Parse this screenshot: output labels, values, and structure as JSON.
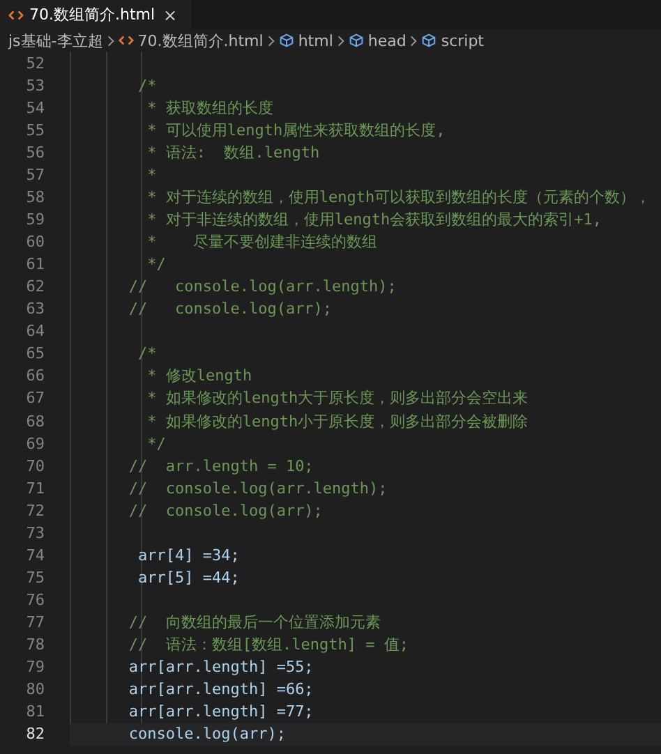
{
  "tabs": [
    {
      "label": "70.数组简介.html",
      "close": "×",
      "selected": true
    }
  ],
  "breadcrumb": [
    {
      "label": "js基础-李立超"
    },
    {
      "label": "70.数组简介.html",
      "kind": "file"
    },
    {
      "label": "html",
      "kind": "symbol"
    },
    {
      "label": "head",
      "kind": "symbol"
    },
    {
      "label": "script",
      "kind": "symbol"
    }
  ],
  "lines": [
    {
      "number": "52",
      "current": false
    },
    {
      "number": "53",
      "kind": "comment",
      "text": "        /*",
      "current": false
    },
    {
      "number": "54",
      "kind": "comment",
      "text": "         * 获取数组的长度",
      "current": false
    },
    {
      "number": "55",
      "kind": "comment",
      "text": "         * 可以使用length属性来获取数组的长度,",
      "current": false
    },
    {
      "number": "56",
      "kind": "comment",
      "text": "         * 语法:  数组.length",
      "current": false
    },
    {
      "number": "57",
      "kind": "comment",
      "text": "         *",
      "current": false
    },
    {
      "number": "58",
      "kind": "comment",
      "text": "         * 对于连续的数组，使用length可以获取到数组的长度（元素的个数），",
      "current": false
    },
    {
      "number": "59",
      "kind": "comment",
      "text": "         * 对于非连续的数组，使用length会获取到数组的最大的索引+1,",
      "current": false
    },
    {
      "number": "60",
      "kind": "comment",
      "text": "         *    尽量不要创建非连续的数组",
      "current": false
    },
    {
      "number": "61",
      "kind": "comment",
      "text": "         */",
      "current": false
    },
    {
      "number": "62",
      "kind": "comment",
      "text": "       //   console.log(arr.length);",
      "current": false
    },
    {
      "number": "63",
      "kind": "comment",
      "text": "       //   console.log(arr);",
      "current": false
    },
    {
      "number": "64",
      "current": false
    },
    {
      "number": "65",
      "kind": "comment",
      "text": "        /*",
      "current": false
    },
    {
      "number": "66",
      "kind": "comment",
      "text": "         * 修改length",
      "current": false
    },
    {
      "number": "67",
      "kind": "comment",
      "text": "         * 如果修改的length大于原长度，则多出部分会空出来",
      "current": false
    },
    {
      "number": "68",
      "kind": "comment",
      "text": "         * 如果修改的length小于原长度，则多出部分会被删除",
      "current": false
    },
    {
      "number": "69",
      "kind": "comment",
      "text": "         */",
      "current": false
    },
    {
      "number": "70",
      "kind": "comment",
      "text": "       //  arr.length = 10;",
      "current": false
    },
    {
      "number": "71",
      "kind": "comment",
      "text": "       //  console.log(arr.length);",
      "current": false
    },
    {
      "number": "72",
      "kind": "comment",
      "text": "       //  console.log(arr);",
      "current": false
    },
    {
      "number": "73",
      "current": false
    },
    {
      "number": "74",
      "kind": "code",
      "text": "        arr[4] =34;",
      "current": false
    },
    {
      "number": "75",
      "kind": "code",
      "text": "        arr[5] =44;",
      "current": false
    },
    {
      "number": "76",
      "current": false
    },
    {
      "number": "77",
      "kind": "comment",
      "text": "       //  向数组的最后一个位置添加元素",
      "current": false
    },
    {
      "number": "78",
      "kind": "comment",
      "text": "       //  语法：数组[数组.length] = 值;",
      "current": false
    },
    {
      "number": "79",
      "kind": "code",
      "text": "       arr[arr.length] =55;",
      "current": false
    },
    {
      "number": "80",
      "kind": "code",
      "text": "       arr[arr.length] =66;",
      "current": false
    },
    {
      "number": "81",
      "kind": "code",
      "text": "       arr[arr.length] =77;",
      "current": false
    },
    {
      "number": "82",
      "kind": "code",
      "text": "       console.log(arr);",
      "current": true
    }
  ]
}
